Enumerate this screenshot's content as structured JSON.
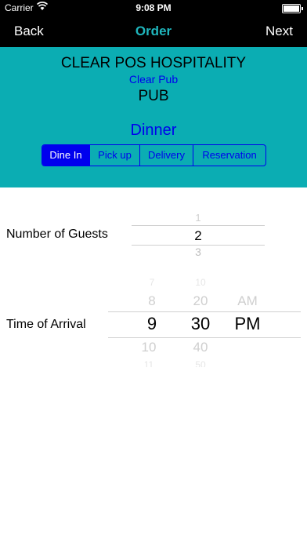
{
  "status_bar": {
    "carrier": "Carrier",
    "time": "9:08 PM"
  },
  "nav": {
    "back": "Back",
    "title": "Order",
    "next": "Next"
  },
  "header": {
    "company": "CLEAR POS HOSPITALITY",
    "venue": "Clear Pub",
    "type": "PUB",
    "meal": "Dinner"
  },
  "order_types": [
    "Dine In",
    "Pick up",
    "Delivery",
    "Reservation"
  ],
  "selected_order_type": "Dine In",
  "guests": {
    "label": "Number of Guests",
    "above": "1",
    "selected": "2",
    "below": "3"
  },
  "arrival": {
    "label": "Time of Arrival",
    "hours": {
      "above2": "7",
      "above": "8",
      "selected": "9",
      "below": "10",
      "below2": "11"
    },
    "minutes": {
      "above2": "10",
      "above": "20",
      "selected": "30",
      "below": "40",
      "below2": "50"
    },
    "ampm": {
      "above": "AM",
      "selected": "PM"
    }
  },
  "colors": {
    "header_bg": "#0badb3",
    "accent": "#0000ee",
    "nav_title": "#1fb6bd"
  }
}
